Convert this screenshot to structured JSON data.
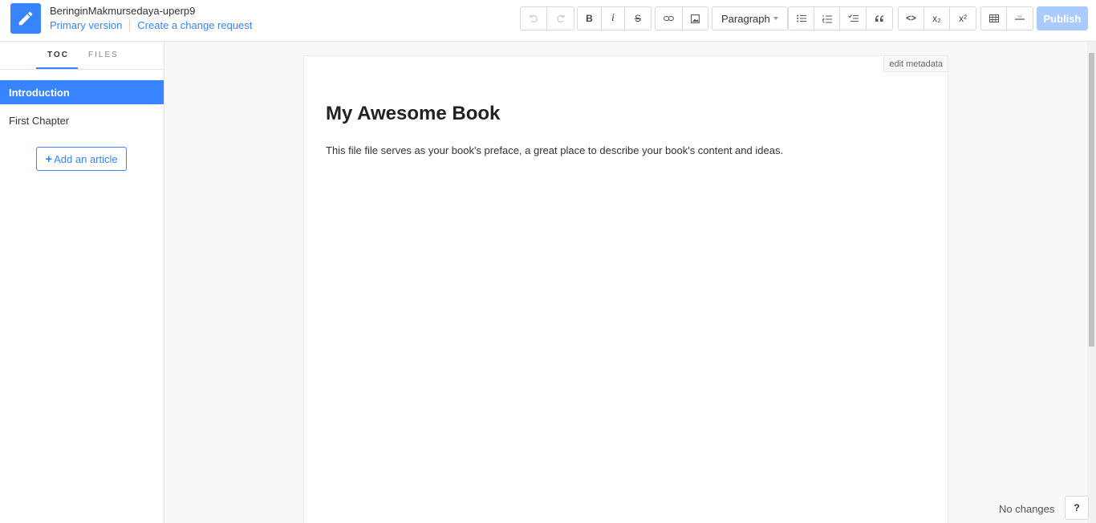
{
  "header": {
    "book_title": "BeringinMakmursedaya-uperp9",
    "primary_version": "Primary version",
    "change_request": "Create a change request"
  },
  "toolbar": {
    "bold": "B",
    "italic": "i",
    "strike": "S",
    "paragraph": "Paragraph",
    "code": "<>",
    "subscript": "x₂",
    "superscript": "x²",
    "publish": "Publish"
  },
  "sidebar": {
    "tabs": [
      "TOC",
      "FILES"
    ],
    "items": [
      {
        "label": "Introduction"
      },
      {
        "label": "First Chapter"
      }
    ],
    "add_article": "Add an article"
  },
  "editor": {
    "edit_metadata": "edit metadata",
    "title": "My Awesome Book",
    "body": "This file file serves as your book's preface, a great place to describe your book's content and ideas."
  },
  "footer": {
    "status": "No changes",
    "help": "?"
  },
  "colors": {
    "accent": "#3884ff",
    "publish_disabled": "#a9cbff"
  }
}
